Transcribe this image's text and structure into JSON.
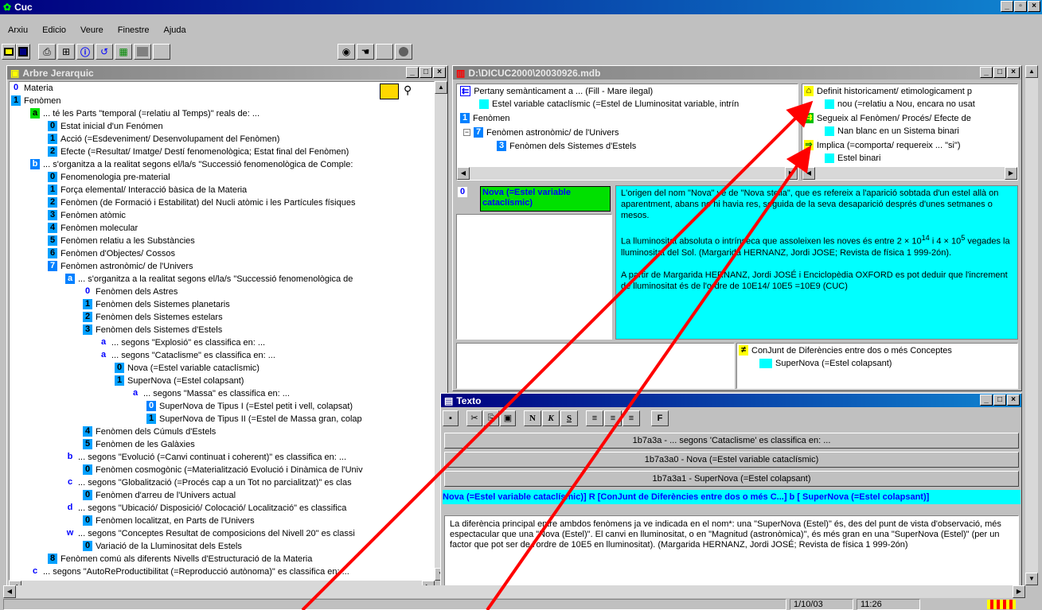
{
  "app": {
    "title": "Cuc"
  },
  "menu": [
    "Arxiu",
    "Edicio",
    "Veure",
    "Finestre",
    "Ajuda"
  ],
  "tree_panel": {
    "title": "Arbre Jerarquic",
    "rows": [
      {
        "badge": "0",
        "text": "Materia"
      },
      {
        "badge": "1",
        "text": "Fenòmen"
      },
      {
        "badge": "a",
        "text": "... té les Parts \"temporal (=relatiu al Temps)\" reals de: ..."
      },
      {
        "badge": "0",
        "text": "Estat inicial d'un Fenómen"
      },
      {
        "badge": "1",
        "text": "Acció (=Esdeveniment/ Desenvolupament del Fenòmen)"
      },
      {
        "badge": "2",
        "text": "Efecte (=Resultat/ Imatge/ Destí fenomenològica; Estat final del Fenòmen)"
      },
      {
        "badge": "b",
        "text": "... s'organitza a la realitat segons el/la/s \"Successió fenomenològica de Comple:"
      },
      {
        "badge": "0",
        "text": "Fenomenologia pre-material"
      },
      {
        "badge": "1",
        "text": "Força elemental/ Interacció bàsica de la Materia"
      },
      {
        "badge": "2",
        "text": "Fenòmen (de Formació i Estabilitat) del Nucli atòmic i les Partícules físiques"
      },
      {
        "badge": "3",
        "text": "Fenòmen atòmic"
      },
      {
        "badge": "4",
        "text": "Fenòmen molecular"
      },
      {
        "badge": "5",
        "text": "Fenòmen relatiu a les Substàncies"
      },
      {
        "badge": "6",
        "text": "Fenòmen d'Objectes/ Cossos"
      },
      {
        "badge": "7",
        "text": "Fenòmen astronòmic/ de l'Univers"
      },
      {
        "badge": "a",
        "text": "... s'organitza a la realitat segons el/la/s \"Successió fenomenològica de"
      },
      {
        "badge": "0",
        "text": "Fenòmen dels Astres"
      },
      {
        "badge": "1",
        "text": "Fenòmen dels Sistemes planetaris"
      },
      {
        "badge": "2",
        "text": "Fenòmen dels Sistemes estelars"
      },
      {
        "badge": "3",
        "text": "Fenòmen dels Sistemes d'Estels"
      },
      {
        "badge": "a",
        "text": "... segons \"Explosió\" es classifica en: ..."
      },
      {
        "badge": "a",
        "text": "... segons \"Cataclisme\" es classifica en: ..."
      },
      {
        "badge": "0",
        "text": "Nova (=Estel variable cataclísmic)"
      },
      {
        "badge": "1",
        "text": "SuperNova (=Estel colapsant)"
      },
      {
        "badge": "a",
        "text": "... segons \"Massa\" es classifica en: ..."
      },
      {
        "badge": "0",
        "text": "SuperNova de Tipus I (=Estel petit i vell, colapsat)"
      },
      {
        "badge": "1",
        "text": "SuperNova de Tipus II (=Estel de Massa gran, colap"
      },
      {
        "badge": "4",
        "text": "Fenòmen dels Cúmuls d'Estels"
      },
      {
        "badge": "5",
        "text": "Fenòmen de les Galàxies"
      },
      {
        "badge": "b",
        "text": "... segons \"Evolució (=Canvi continuat i coherent)\" es classifica en: ..."
      },
      {
        "badge": "0",
        "text": "Fenòmen cosmogònic (=Materialització Evolució i Dinàmica de l'Univ"
      },
      {
        "badge": "c",
        "text": "... segons \"Globalització (=Procés cap a un Tot no parcialitzat)\" es clas"
      },
      {
        "badge": "0",
        "text": "Fenòmen d'arreu de l'Univers actual"
      },
      {
        "badge": "d",
        "text": "... segons \"Ubicació/ Disposició/ Colocació/ Localització\" es classifica"
      },
      {
        "badge": "0",
        "text": "Fenòmen localitzat, en Parts de l'Univers"
      },
      {
        "badge": "w",
        "text": "... segons \"Conceptes Resultat de composicions del Nivell 20\" es classi"
      },
      {
        "badge": "0",
        "text": "Variació de la Lluminositat dels Estels"
      },
      {
        "badge": "8",
        "text": "Fenòmen comú als diferents Nivells d'Estructuració de la Materia"
      },
      {
        "badge": "c",
        "text": "... segons \"AutoReProductibilitat (=Reproducció autònoma)\" es classifica en: ..."
      }
    ]
  },
  "db_panel": {
    "title": "D:\\DICUC2000\\20030926.mdb",
    "top_left": {
      "header": "Pertany semànticament a ... (Fill - Mare ilegal)",
      "item": "Estel variable cataclísmic (=Estel de Lluminositat variable, intrín",
      "rows": [
        {
          "badge": "1",
          "text": "Fenòmen"
        },
        {
          "badge": "7",
          "text": "Fenòmen astronòmic/ de l'Univers"
        },
        {
          "badge": "3",
          "text": "Fenòmen dels Sistemes d'Estels"
        }
      ]
    },
    "top_right": {
      "h1": "Definit historicament/ etimologicament p",
      "i1": "nou (=relatiu a Nou, encara no usat",
      "h2": "Segueix al Fenòmen/ Procés/ Efecte de",
      "i2": "Nan blanc en un Sistema binari",
      "h3": "Implica (=comporta/ requereix ... \"si\")",
      "i3": "Estel binari"
    },
    "selected": {
      "badge": "0",
      "label": "Nova (=Estel variable cataclísmic)"
    },
    "description": {
      "p1": "L'origen del nom \"Nova\" ve de \"Nova stella\", que es refereix a l'aparició sobtada d'un estel allà on aparentment, abans no hi havia res, seguida de la seva desaparició després d'unes setmanes o mesos.",
      "p2a": "La lluminositat absoluta o intrínseca que assoleixen les noves és entre 2 × 10",
      "p2sup1": "14",
      "p2b": " i 4 × 10",
      "p2sup2": "5",
      "p2c": " vegades la lluminositat del Sol. (Margarida HERNANZ, Jordi JOSE; Revista de física 1 999-2ón).",
      "p3": "A partir de Margarida HERNANZ, Jordi JOSÉ i Enciclopèdia OXFORD es pot deduir que l'increment de lluminositat és de l'ordre de 10E14/ 10E5 =10E9 (CUC)"
    },
    "diff": {
      "header": "ConJunt de Diferències entre dos o més Conceptes",
      "item": "SuperNova (=Estel colapsant)"
    }
  },
  "texto": {
    "title": "Texto",
    "toolbar": [
      "N",
      "K",
      "S",
      "F"
    ],
    "buttons": [
      "1b7a3a - ... segons 'Cataclisme' es classifica en: ...",
      "1b7a3a0 - Nova (=Estel variable cataclísmic)",
      "1b7a3a1 - SuperNova (=Estel colapsant)"
    ],
    "relation": "Nova (=Estel variable cataclísmic)]  R  [ConJunt de Diferències entre dos o més C...]  b  [ SuperNova (=Estel colapsant)]",
    "body": "La diferència principal entre ambdos fenòmens ja ve indicada en el nom*: una \"SuperNova (Estel)\" és, des del punt de vista d'observació, més espectacular que una \"Nova (Estel)\". El canvi en lluminositat, o en \"Magnitud (astronòmica)\", és més gran en una \"SuperNova (Estel)\" (per un factor que pot ser de l'ordre de 10E5 en lluminositat). (Margarida HERNANZ, Jordi JOSÉ; Revista de física 1 999-2ón)"
  },
  "status": {
    "date": "1/10/03",
    "time": "11:26"
  },
  "colors": {
    "cyan": "#00ffff",
    "green": "#00e000",
    "titlebar": "#000080",
    "arrow": "#ff0000"
  }
}
